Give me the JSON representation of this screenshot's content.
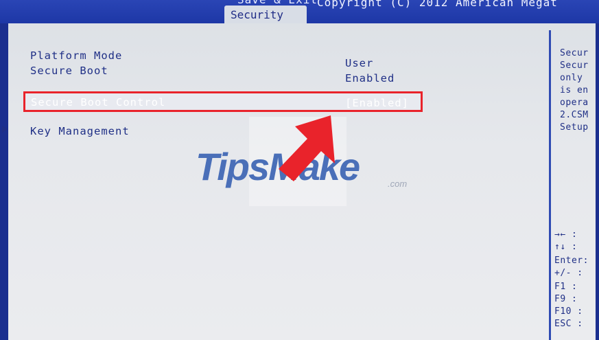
{
  "header": {
    "partial_tab": "Save & Exit",
    "active_tab": "Security",
    "copyright": "Copyright (C) 2012 American Megat"
  },
  "settings": {
    "platform_mode": {
      "label": "Platform Mode",
      "value": "User"
    },
    "secure_boot": {
      "label": "Secure Boot",
      "value": "Enabled"
    },
    "secure_boot_control": {
      "label": "Secure Boot Control",
      "value": "[Enabled]"
    },
    "key_management": {
      "label": "Key Management"
    }
  },
  "help": {
    "lines": [
      "Secur",
      "Secur",
      "only",
      "is en",
      "opera",
      "2.CSM",
      "Setup"
    ]
  },
  "keys": {
    "lines": [
      "→←  :",
      "↑↓  :",
      "Enter:",
      "+/-  :",
      "F1   :",
      "F9   :",
      "F10  :",
      "ESC  :"
    ]
  },
  "watermark": {
    "text": "TipsMake",
    "suffix": ".com"
  },
  "colors": {
    "accent_red": "#e9232b",
    "bios_blue": "#1b2f8f",
    "text_blue": "#1f2f86"
  }
}
